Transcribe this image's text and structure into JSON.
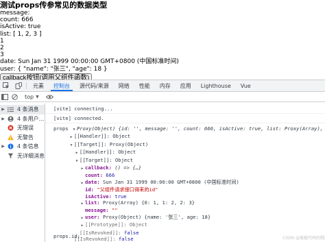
{
  "page": {
    "title": "测试props传参常见的数据类型",
    "lines": [
      "message:",
      "count: 666",
      "isActive: true",
      "list: [ 1, 2, 3 ]",
      "1",
      "2",
      "3",
      "date: Sun Jan 31 1999 00:00:00 GMT+0800 (中国标准时间)",
      "user: { \"name\": \"张三\", \"age\": 18 }"
    ],
    "button_label": "callback按钮(调用父组件函数)"
  },
  "devtools": {
    "tabs": [
      "元素",
      "控制台",
      "源代码/来源",
      "网络",
      "性能",
      "内存",
      "应用",
      "Lighthouse",
      "Vue"
    ],
    "active_tab": "控制台",
    "toolbar": {
      "context": "top"
    },
    "sidebar": [
      {
        "label": "4 条消息",
        "icon": "list-icon",
        "color": "#5f6368"
      },
      {
        "label": "4 条用户...",
        "icon": "user-icon",
        "color": "#5f6368"
      },
      {
        "label": "无错误",
        "icon": "error-icon",
        "color": "#d93025"
      },
      {
        "label": "无警告",
        "icon": "warning-icon",
        "color": "#f9ab00"
      },
      {
        "label": "4 条信息",
        "icon": "info-icon",
        "color": "#1a73e8"
      },
      {
        "label": "无详细消息",
        "icon": "verbose-icon",
        "color": "#5f6368"
      }
    ],
    "console": {
      "msg1": "[vite] connecting...",
      "msg2": "[vite] connected.",
      "props_label": "props",
      "props_summary": "Proxy(Object) {id: '', message: '', count: 666, isActive: true, list: Proxy(Array), …}",
      "handler": "[[Handler]]: Object",
      "target": "[[Target]]: Proxy(Object)",
      "inner_handler": "[[Handler]]: Object",
      "inner_target": "[[Target]]: Object",
      "callback_key": "callback:",
      "callback_val": "() => {…}",
      "count_key": "count:",
      "count_val": "666",
      "date_key": "date:",
      "date_val": "Sun Jan 31 1999 00:00:00 GMT+0800 (中国标准时间)",
      "id_key": "id:",
      "id_val": "\"父组件请求接口得来的id\"",
      "isActive_key": "isActive:",
      "isActive_val": "true",
      "list_key": "list:",
      "list_val": "Proxy(Array) {0: 1, 1: 2, 2: 3}",
      "message_key": "message:",
      "message_val": "\"\"",
      "user_key": "user:",
      "user_val": "Proxy(Object) {name: '张三', age: 18}",
      "prototype": "[[Prototype]]: Object",
      "inner_revoked_key": "[[IsRevoked]]:",
      "inner_revoked_val": "false",
      "outer_revoked_key": "[[IsRevoked]]:",
      "outer_revoked_val": "false",
      "prompt": "props.id;"
    },
    "watermark": "CSDN @爱敲代码的程序员"
  }
}
